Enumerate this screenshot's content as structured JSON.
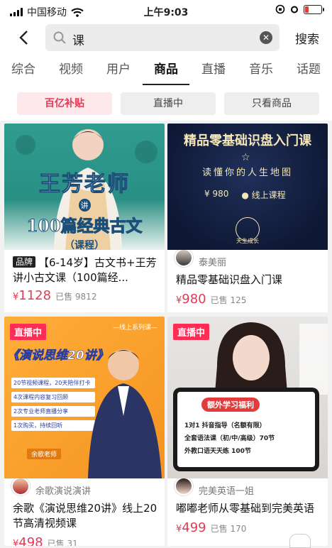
{
  "status": {
    "carrier": "中国移动",
    "time": "上午9:03"
  },
  "search": {
    "query": "课",
    "button": "搜索"
  },
  "tabs": [
    "综合",
    "视频",
    "用户",
    "商品",
    "直播",
    "音乐",
    "话题"
  ],
  "filters": [
    "百亿补贴",
    "直播中",
    "只看商品"
  ],
  "products": [
    {
      "badge": "品牌",
      "title": "【6-14岁】古文书+王芳讲小古文课（100篇经...",
      "price": "1128",
      "sold": "已售 9812",
      "image": {
        "line1": "王芳老师",
        "mid": "讲",
        "line2": "100篇经典古文",
        "line3": "（课程）"
      }
    },
    {
      "author": "泰美丽",
      "title": "精品零基础识盘入门课",
      "price": "980",
      "sold": "已售 125",
      "image": {
        "title": "精品零基础识盘入门课",
        "subtitle": "读懂你的人生地图",
        "price_tag": "980",
        "mode": "线上课程",
        "logo_text": "天生成长"
      }
    },
    {
      "live": "直播中",
      "author": "余歌演说演讲",
      "title": "余歌《演说思维20讲》线上20节高清视频课",
      "price": "498",
      "sold": "已售 31",
      "image": {
        "series": "—线上系列课—",
        "headline": "《演说思维20讲》",
        "bullets": [
          "20节视频课程，20天陪伴打卡",
          "4次课程内容复习回顾",
          "2次专业老师直播分享",
          "1次购买，持续回听"
        ],
        "teacher": "余歌老师"
      }
    },
    {
      "live": "直播中",
      "author": "完美英语一姐",
      "title": "嘟嘟老师从零基础到完美英语",
      "price": "499",
      "sold": "已售 170",
      "image": {
        "banner": "额外学习福利",
        "lines": [
          "1对1 抖音指导（名额有限）",
          "全套语法课（初/中/高级）70节",
          "外教口语天天练 100节"
        ]
      }
    }
  ],
  "colors": {
    "accent": "#e33a55",
    "live": "#ff2d55"
  }
}
